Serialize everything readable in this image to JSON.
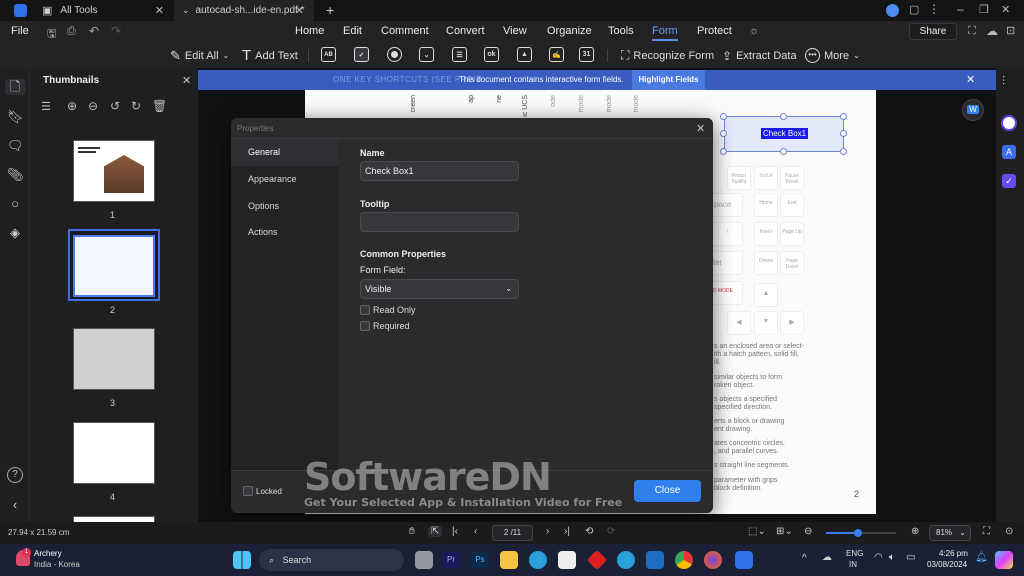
{
  "titlebar": {
    "tabs": [
      {
        "label": "All Tools"
      },
      {
        "label": "autocad-sh...ide-en.pdf *"
      }
    ],
    "new_tab": "+"
  },
  "menubar": {
    "file": "File",
    "items": [
      "Home",
      "Edit",
      "Comment",
      "Convert",
      "View",
      "Organize",
      "Tools",
      "Form",
      "Protect"
    ],
    "active": "Form",
    "share": "Share"
  },
  "toolbar": {
    "edit_all": "Edit All",
    "add_text": "Add Text",
    "form_icons": [
      "text-field",
      "check-box",
      "radio-button",
      "dropdown",
      "list-box",
      "button",
      "image-field",
      "signature-field",
      "date-field"
    ],
    "ok_label": "ok",
    "date_label": "31",
    "textfield_label": "AB",
    "recognize_form": "Recognize Form",
    "extract_data": "Extract Data",
    "more": "More"
  },
  "thumbnails": {
    "title": "Thumbnails",
    "pages": [
      "1",
      "2",
      "3",
      "4"
    ],
    "selected": "2"
  },
  "banner": {
    "doc_heading": "ONE KEY SHORTCUTS (SEE PRINT",
    "message": "This document contains interactive form fields.",
    "highlight_button": "Highlight Fields"
  },
  "page": {
    "column_headers": [
      "creen",
      "ap",
      "ne",
      "ic UCS",
      "ode",
      "mode",
      "mode",
      "mode"
    ],
    "checkbox_field": "Check Box1",
    "keys": [
      "Prtscn SysRq",
      "ScrLK",
      "Pause Break",
      "pace",
      "Home",
      "End",
      "\\",
      "Insert",
      "Page Up",
      "ter",
      "Delete",
      "Page Down",
      "D MODE",
      "▲",
      "◀",
      "▼",
      "▶"
    ],
    "desc_lines": [
      "s an enclosed area or select-",
      "ith a hatch pattern, solid fill,",
      "ill.",
      "similar objects to form",
      "roken object.",
      "s objects a specified",
      "specified direction.",
      "erts a block or drawing",
      "ent drawing.",
      "ates concentric circles,",
      ", and parallel curves.",
      "s straight line segments.",
      "parameter with grips",
      "block definition."
    ],
    "page_number": "2"
  },
  "dialog": {
    "title": "Properties",
    "nav": [
      "General",
      "Appearance",
      "Options",
      "Actions"
    ],
    "active_nav": "General",
    "name_label": "Name",
    "name_value": "Check Box1",
    "tooltip_label": "Tooltip",
    "tooltip_value": "",
    "common_props": "Common Properties",
    "form_field_label": "Form Field:",
    "form_field_value": "Visible",
    "read_only": "Read Only",
    "required": "Required",
    "locked": "Locked",
    "close": "Close"
  },
  "statusbar": {
    "page_size": "27.94 x 21.59 cm",
    "page_indicator": "2 /11",
    "zoom": "81%",
    "zoom_slider_fraction": 0.45
  },
  "taskbar": {
    "weather_title": "Archery",
    "weather_sub": "India - Korea",
    "badge": "1",
    "search": "Search",
    "pinned": [
      "Task View",
      "Premiere Pro",
      "Photoshop",
      "File Explorer",
      "Edge",
      "Microsoft Store",
      "App",
      "Get Help",
      "Outlook",
      "Chrome",
      "Firefox",
      "PDFelement"
    ],
    "lang_top": "ENG",
    "lang_bottom": "IN",
    "time": "4:26 pm",
    "date": "03/08/2024"
  },
  "watermark": {
    "title": "SoftwareDN",
    "subtitle": "Get Your Selected App & Installation Video for Free"
  },
  "colors": {
    "accent": "#2f80ed",
    "banner": "#3a5bbf",
    "form_tab": "#5b8def"
  }
}
